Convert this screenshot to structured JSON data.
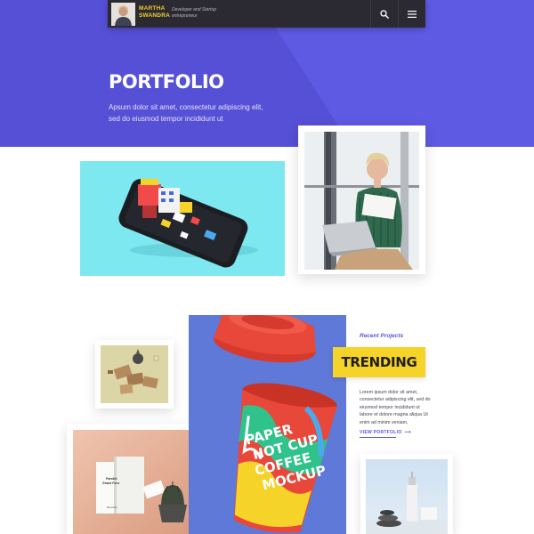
{
  "header": {
    "brand_name": "MARTHA SWANDRA",
    "brand_tagline": "Developer and Startup entrepreneur",
    "icons": [
      "search-icon",
      "hamburger-menu-icon"
    ]
  },
  "hero": {
    "title": "PORTFOLIO",
    "description": "Apsum dolor sit amet, consectetur adipiscing elit, sed do eiusmod tempor incididunt ut"
  },
  "trending": {
    "label": "Recent Projects",
    "title": "TRENDING",
    "description": "Lorem ipsum dolor sit amet, consectetur adipiscing elit, sed do eiusmod tempor incididunt ut labore et dolore magna aliqua Ut enim ad minim veniam,",
    "link_label": "VIEW PORTFOLIO",
    "link_arrow": "⟶"
  },
  "mockups": {
    "cup_text": "PAPER HOT CUP COFFEE MOCKUP",
    "book_title": "Parallel Grand Font",
    "book_author": "Maxmilian"
  },
  "colors": {
    "primary": "#5a55dd",
    "accent": "#f5d328",
    "navbar": "#2b2a33"
  }
}
